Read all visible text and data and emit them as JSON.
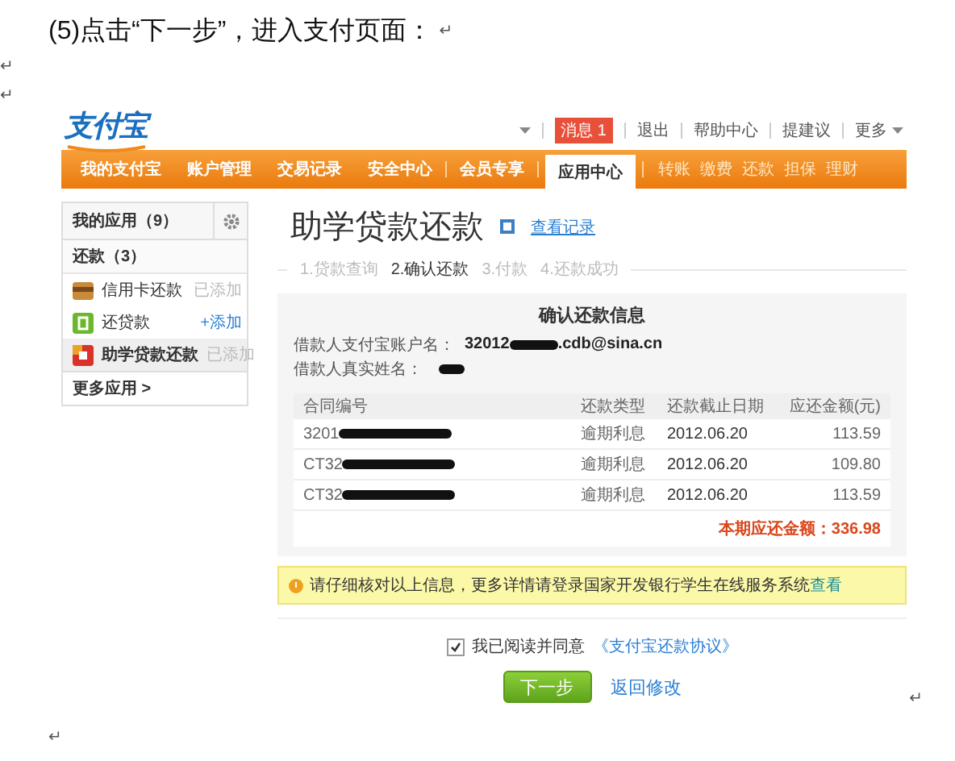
{
  "document": {
    "heading": "(5)点击“下一步”，进入支付页面：",
    "marks": [
      "↵",
      "↵",
      "↵",
      "↵",
      "↵"
    ]
  },
  "header": {
    "logo": "支付宝",
    "message_badge": "消息 1",
    "links": [
      "退出",
      "帮助中心",
      "提建议"
    ],
    "more": "更多"
  },
  "nav": {
    "items": [
      {
        "label": "我的支付宝",
        "selected": false
      },
      {
        "label": "账户管理",
        "selected": false
      },
      {
        "label": "交易记录",
        "selected": false
      },
      {
        "label": "安全中心",
        "selected": false
      },
      {
        "label": "会员专享",
        "selected": false
      },
      {
        "label": "应用中心",
        "selected": true
      }
    ],
    "quick_links": [
      "转账",
      "缴费",
      "还款",
      "担保",
      "理财"
    ]
  },
  "sidebar": {
    "title": "我的应用（9）",
    "section": "还款（3）",
    "apps": [
      {
        "name": "信用卡还款",
        "status": "已添加",
        "added": true,
        "selected": false
      },
      {
        "name": "还贷款",
        "status": "+添加",
        "added": false,
        "selected": false
      },
      {
        "name": "助学贷款还款",
        "status": "已添加",
        "added": true,
        "selected": true
      }
    ],
    "more": "更多应用 >"
  },
  "main": {
    "title": "助学贷款还款",
    "records_link": "查看记录",
    "steps": [
      {
        "label": "1.贷款查询",
        "selected": false
      },
      {
        "label": "2.确认还款",
        "selected": true
      },
      {
        "label": "3.付款",
        "selected": false
      },
      {
        "label": "4.还款成功",
        "selected": false
      }
    ],
    "info": {
      "title": "确认还款信息",
      "fields": [
        {
          "label": "借款人支付宝账户名：",
          "prefix": "32012",
          "suffix": ".cdb@sina.cn"
        },
        {
          "label": "借款人真实姓名："
        }
      ]
    },
    "table": {
      "columns": [
        "合同编号",
        "还款类型",
        "还款截止日期",
        "应还金额(元)"
      ],
      "rows": [
        {
          "contract": "3201",
          "type": "逾期利息",
          "due": "2012.06.20",
          "amount": "113.59"
        },
        {
          "contract": "CT32",
          "type": "逾期利息",
          "due": "2012.06.20",
          "amount": "109.80"
        },
        {
          "contract": "CT32",
          "type": "逾期利息",
          "due": "2012.06.20",
          "amount": "113.59"
        }
      ],
      "total": "本期应还金额：336.98"
    },
    "notice": {
      "text": "请仔细核对以上信息，更多详情请登录国家开发银行学生在线服务系统",
      "link": "查看"
    },
    "agreement": {
      "checked": true,
      "text": "我已阅读并同意",
      "link": "《支付宝还款协议》"
    },
    "next_button": "下一步",
    "back_link": "返回修改"
  }
}
